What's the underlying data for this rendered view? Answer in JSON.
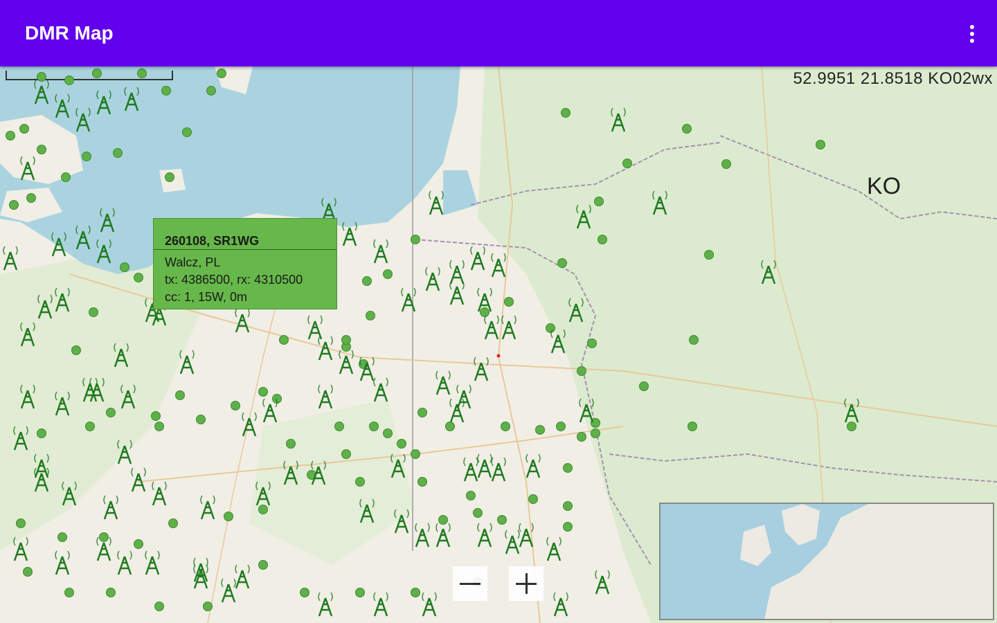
{
  "app": {
    "title": "DMR Map",
    "overflow_icon": "more-vert-icon"
  },
  "map": {
    "coordinates_readout": "52.9951  21.8518  KO02wx",
    "grid_square_label": "KO",
    "scale_label": "",
    "colors": {
      "sea": "#aad3df",
      "land": "#f1eee6",
      "forest": "#d6e8c4",
      "marker": "#1f7a1f",
      "accent": "#6200ee"
    }
  },
  "popup": {
    "title": "260108, SR1WG",
    "location": "Walcz, PL",
    "frequencies": "tx: 4386500, rx: 4310500",
    "details": "cc: 1, 15W, 0m"
  },
  "zoom": {
    "out_icon": "minus-icon",
    "in_icon": "plus-icon"
  },
  "minimap": {
    "label": "overview-map"
  }
}
